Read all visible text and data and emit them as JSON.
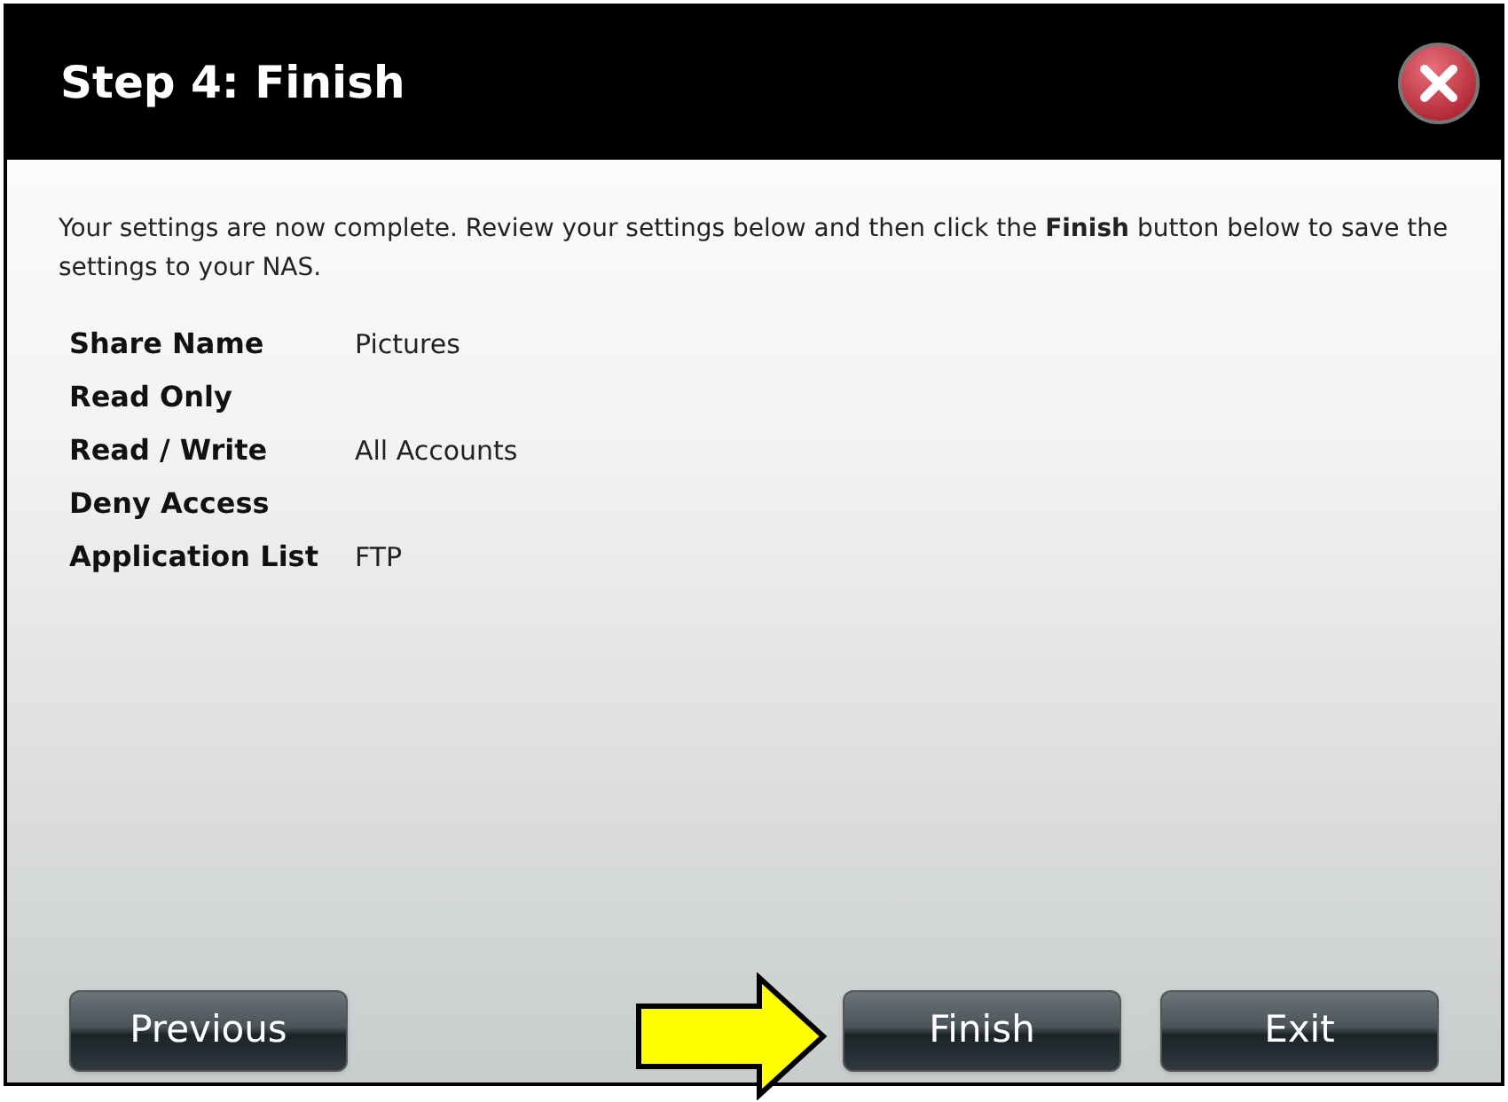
{
  "window": {
    "title": "Step 4: Finish"
  },
  "intro": "Your settings are now complete. Review your settings below and then click the **Finish** button below to save the settings to your NAS.",
  "settings": [
    {
      "label": "Share Name",
      "value": "Pictures"
    },
    {
      "label": "Read Only"
    },
    {
      "label": "Read / Write",
      "value": "All Accounts"
    },
    {
      "label": "Deny Access"
    },
    {
      "label": "Application List",
      "value": "FTP"
    }
  ],
  "buttons": [
    {
      "label": "Previous",
      "kind": "left"
    },
    {
      "label": "Finish",
      "kind": "right",
      "highlighted": true
    },
    {
      "label": "Exit",
      "kind": "right",
      "highlighted": false
    }
  ]
}
